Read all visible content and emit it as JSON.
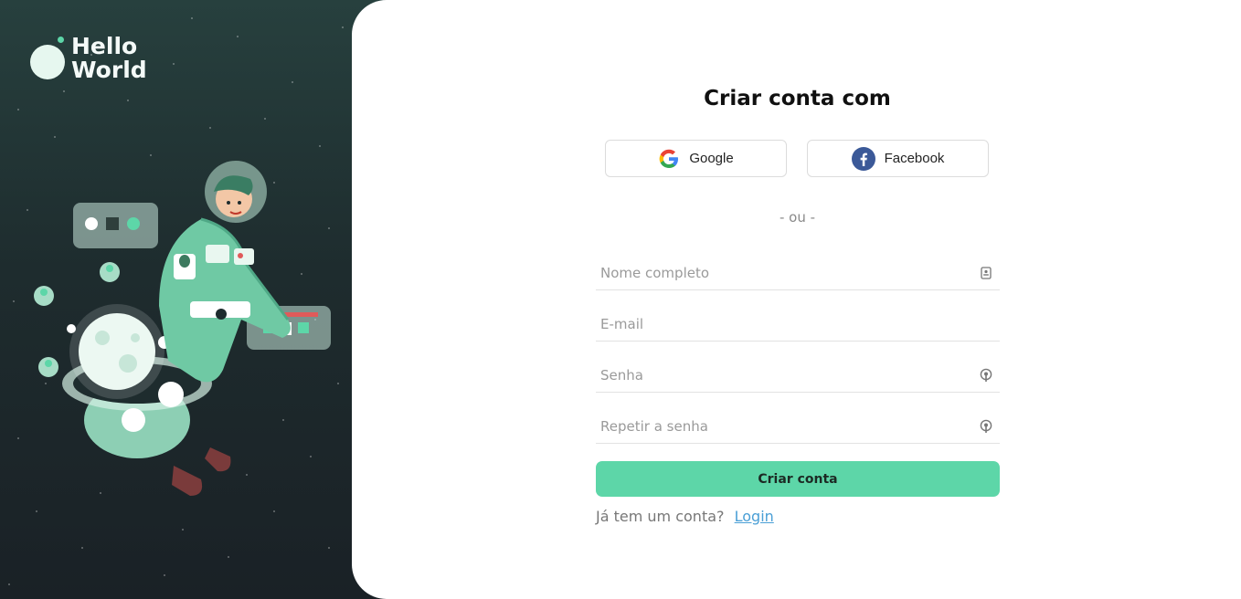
{
  "brand": {
    "line1": "Hello",
    "line2": "World"
  },
  "form": {
    "title": "Criar conta com",
    "google_label": "Google",
    "facebook_label": "Facebook",
    "divider": "- ou -",
    "fields": {
      "name_placeholder": "Nome completo",
      "email_placeholder": "E-mail",
      "password_placeholder": "Senha",
      "repeat_placeholder": "Repetir a senha"
    },
    "submit_label": "Criar conta",
    "has_account_text": "Já tem um conta?",
    "login_label": "Login"
  },
  "icons": {
    "name_field": "id-card-icon",
    "password_field": "lock-icon",
    "repeat_field": "lock-icon",
    "google": "google-icon",
    "facebook": "facebook-icon"
  },
  "colors": {
    "accent": "#5dd6a8",
    "link": "#4a9fd6",
    "left_bg": "#1e2c2e",
    "facebook": "#3b5998"
  }
}
